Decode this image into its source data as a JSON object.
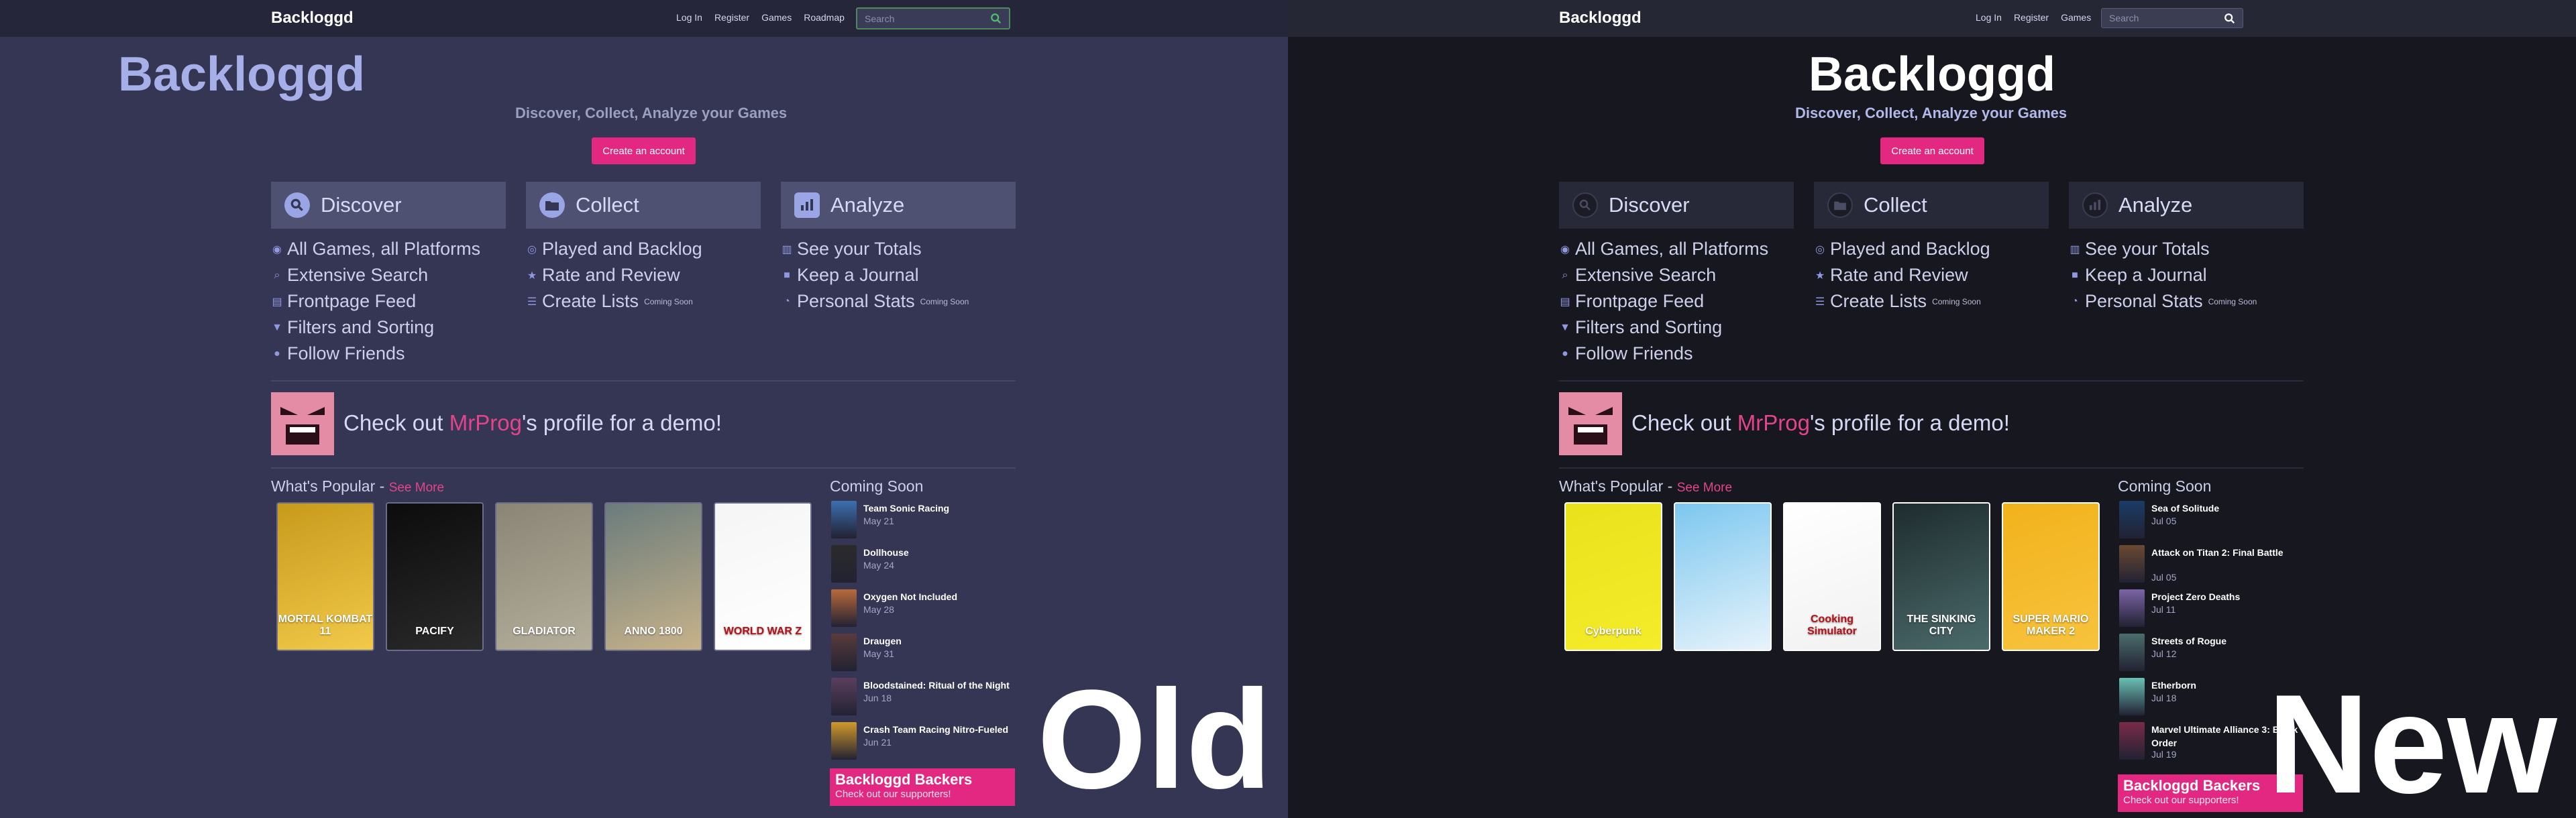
{
  "brand": "Backloggd",
  "nav": [
    "Log In",
    "Register",
    "Games",
    "Roadmap"
  ],
  "search_placeholder": "Search",
  "hero": {
    "title": "Backloggd",
    "subtitle": "Discover, Collect, Analyze your Games",
    "cta": "Create an account"
  },
  "features": [
    {
      "title": "Discover",
      "items": [
        {
          "label": "All Games, all Platforms",
          "soon": ""
        },
        {
          "label": "Extensive Search",
          "soon": ""
        },
        {
          "label": "Frontpage Feed",
          "soon": ""
        },
        {
          "label": "Filters and Sorting",
          "soon": ""
        },
        {
          "label": "Follow Friends",
          "soon": ""
        }
      ]
    },
    {
      "title": "Collect",
      "items": [
        {
          "label": "Played and Backlog",
          "soon": ""
        },
        {
          "label": "Rate and Review",
          "soon": ""
        },
        {
          "label": "Create Lists",
          "soon": "Coming Soon"
        }
      ]
    },
    {
      "title": "Analyze",
      "items": [
        {
          "label": "See your Totals",
          "soon": ""
        },
        {
          "label": "Keep a Journal",
          "soon": ""
        },
        {
          "label": "Personal Stats",
          "soon": "Coming Soon"
        }
      ]
    }
  ],
  "demo": {
    "prefix": "Check out ",
    "user": "MrProg",
    "suffix": "'s profile for a demo!"
  },
  "popular": {
    "title": "What's Popular - ",
    "see_more": "See More"
  },
  "coming_soon_title": "Coming Soon",
  "old": {
    "label": "Old",
    "popular_covers": [
      {
        "title": "MORTAL KOMBAT 11",
        "colors": [
          "#c79a1c",
          "#f2c94a"
        ]
      },
      {
        "title": "PACIFY",
        "colors": [
          "#0c0c0c",
          "#2a2a2a"
        ]
      },
      {
        "title": "GLADIATOR",
        "colors": [
          "#8a8575",
          "#b4ae9b"
        ]
      },
      {
        "title": "ANNO 1800",
        "colors": [
          "#6b7c7c",
          "#c7b28a"
        ]
      },
      {
        "title": "WORLD WAR Z",
        "colors": [
          "#f5f5f5",
          "#ffffff"
        ]
      }
    ],
    "coming_soon": [
      {
        "name": "Team Sonic Racing",
        "date": "May 21",
        "color": "#3c6fb0"
      },
      {
        "name": "Dollhouse",
        "date": "May 24",
        "color": "#2b2b2b"
      },
      {
        "name": "Oxygen Not Included",
        "date": "May 28",
        "color": "#b96a3a"
      },
      {
        "name": "Draugen",
        "date": "May 31",
        "color": "#5a3b3b"
      },
      {
        "name": "Bloodstained: Ritual of the Night",
        "date": "Jun 18",
        "color": "#5b3f5e"
      },
      {
        "name": "Crash Team Racing Nitro-Fueled",
        "date": "Jun 21",
        "color": "#d09a2a"
      }
    ]
  },
  "new": {
    "label": "New",
    "popular_covers": [
      {
        "title": "Cyberpunk",
        "colors": [
          "#e9e21b",
          "#f5ec2a"
        ]
      },
      {
        "title": "",
        "colors": [
          "#7cc7ef",
          "#e7f3fb"
        ]
      },
      {
        "title": "Cooking Simulator",
        "colors": [
          "#ffffff",
          "#f1f1f1"
        ]
      },
      {
        "title": "THE SINKING CITY",
        "colors": [
          "#1e2c2e",
          "#4b6a6a"
        ]
      },
      {
        "title": "SUPER MARIO MAKER 2",
        "colors": [
          "#f2b21c",
          "#f7c33d"
        ]
      }
    ],
    "coming_soon": [
      {
        "name": "Sea of Solitude",
        "date": "Jul 05",
        "color": "#1a3c66"
      },
      {
        "name": "Attack on Titan 2: Final Battle",
        "date": "Jul 05",
        "color": "#6b4a33"
      },
      {
        "name": "Project Zero Deaths",
        "date": "Jul 11",
        "color": "#7c64a6"
      },
      {
        "name": "Streets of Rogue",
        "date": "Jul 12",
        "color": "#4b6d6c"
      },
      {
        "name": "Etherborn",
        "date": "Jul 18",
        "color": "#6ac0b4"
      },
      {
        "name": "Marvel Ultimate Alliance 3: Black Order",
        "date": "Jul 19",
        "color": "#7a2b48"
      }
    ]
  },
  "backers": {
    "title": "Backloggd Backers",
    "subtitle": "Check out our supporters!"
  },
  "colors": {
    "accent": "#e32882",
    "old_bg": "#353653",
    "new_bg": "#16171f"
  }
}
